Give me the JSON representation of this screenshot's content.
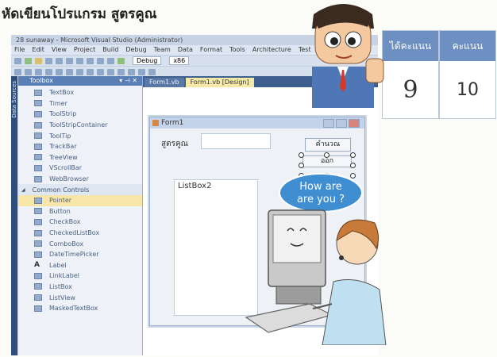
{
  "heading": "หัดเขียนโปรแกรม สูตรคูณ",
  "scores": {
    "earned_label": "ได้คะแนน",
    "earned_value": "9",
    "total_label": "คะแนน",
    "total_value": "10"
  },
  "window": {
    "title": "28 sunaway - Microsoft Visual Studio (Administrator)",
    "menu": [
      "File",
      "Edit",
      "View",
      "Project",
      "Build",
      "Debug",
      "Team",
      "Data",
      "Format",
      "Tools",
      "Architecture",
      "Test"
    ],
    "config": "Debug",
    "platform": "x86"
  },
  "side_tab": "Data Sources",
  "toolbox": {
    "title": "Toolbox",
    "items": [
      {
        "label": "TextBox",
        "type": "item"
      },
      {
        "label": "Timer",
        "type": "item"
      },
      {
        "label": "ToolStrip",
        "type": "item"
      },
      {
        "label": "ToolStripContainer",
        "type": "item"
      },
      {
        "label": "ToolTip",
        "type": "item"
      },
      {
        "label": "TrackBar",
        "type": "item"
      },
      {
        "label": "TreeView",
        "type": "item"
      },
      {
        "label": "VScrollBar",
        "type": "item"
      },
      {
        "label": "WebBrowser",
        "type": "item"
      },
      {
        "label": "Common Controls",
        "type": "section"
      },
      {
        "label": "Pointer",
        "type": "selected"
      },
      {
        "label": "Button",
        "type": "item"
      },
      {
        "label": "CheckBox",
        "type": "item"
      },
      {
        "label": "CheckedListBox",
        "type": "item"
      },
      {
        "label": "ComboBox",
        "type": "item"
      },
      {
        "label": "DateTimePicker",
        "type": "item"
      },
      {
        "label": "Label",
        "type": "label"
      },
      {
        "label": "LinkLabel",
        "type": "item"
      },
      {
        "label": "ListBox",
        "type": "item"
      },
      {
        "label": "ListView",
        "type": "item"
      },
      {
        "label": "MaskedTextBox",
        "type": "item"
      }
    ]
  },
  "tabs": [
    {
      "label": "Form1.vb",
      "active": false
    },
    {
      "label": "Form1.vb [Design]",
      "active": true
    }
  ],
  "form": {
    "title": "Form1",
    "label": "สูตรคูณ",
    "calc_button": "คำนวณ",
    "exit_button": "ออก",
    "listbox": "ListBox2"
  },
  "speech": {
    "line1": "How are",
    "line2": "are you ?"
  }
}
